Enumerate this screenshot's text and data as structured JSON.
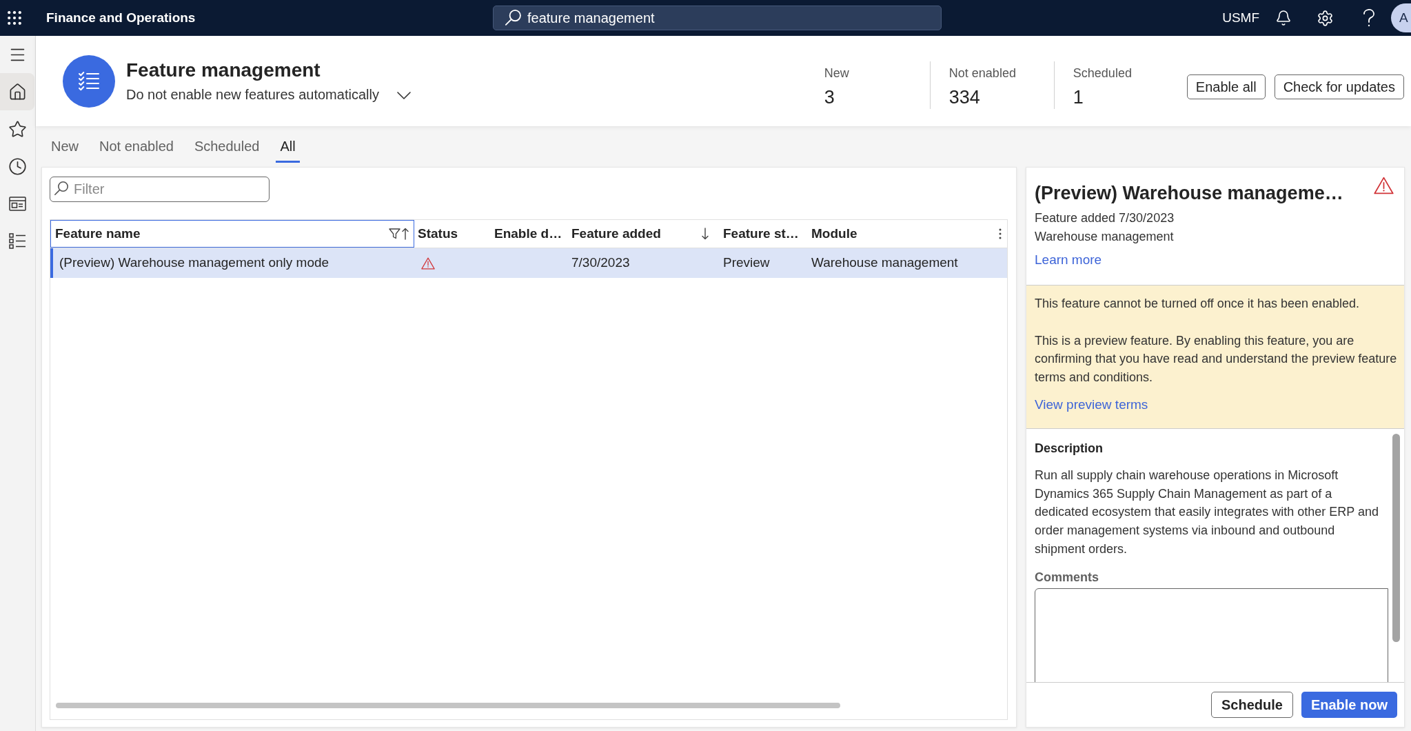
{
  "top_bar": {
    "app_title": "Finance and Operations",
    "search": {
      "value": "feature management"
    },
    "company": "USMF",
    "avatar": {
      "initial": "A"
    }
  },
  "nav_items": [
    {
      "kind": "home",
      "selected": true
    },
    {
      "kind": "favorites",
      "selected": false
    },
    {
      "kind": "recent",
      "selected": false
    },
    {
      "kind": "workspaces",
      "selected": false
    },
    {
      "kind": "modules",
      "selected": false
    }
  ],
  "header": {
    "title": "Feature management",
    "mode_dropdown": {
      "value": "Do not enable new features automatically"
    },
    "stats": [
      {
        "label": "New",
        "value": "3"
      },
      {
        "label": "Not enabled",
        "value": "334"
      },
      {
        "label": "Scheduled",
        "value": "1"
      }
    ],
    "buttons": [
      {
        "label": "Enable all"
      },
      {
        "label": "Check for updates"
      }
    ]
  },
  "tabs": [
    {
      "label": "New",
      "selected": false
    },
    {
      "label": "Not enabled",
      "selected": false
    },
    {
      "label": "Scheduled",
      "selected": false
    },
    {
      "label": "All",
      "selected": true
    }
  ],
  "filter": {
    "placeholder": "Filter"
  },
  "table": {
    "columns": [
      {
        "label": "Feature name",
        "focused": true,
        "filtered": true,
        "sorted_ascending": true,
        "sorted_descending": false
      },
      {
        "label": "Status",
        "focused": false,
        "filtered": false,
        "sorted_ascending": false,
        "sorted_descending": false
      },
      {
        "label": "Enable d…",
        "focused": false,
        "filtered": false,
        "sorted_ascending": false,
        "sorted_descending": false
      },
      {
        "label": "Feature added",
        "focused": false,
        "filtered": false,
        "sorted_ascending": false,
        "sorted_descending": true
      },
      {
        "label": "Feature st…",
        "focused": false,
        "filtered": false,
        "sorted_ascending": false,
        "sorted_descending": false
      },
      {
        "label": "Module",
        "focused": false,
        "filtered": false,
        "sorted_ascending": false,
        "sorted_descending": false
      }
    ],
    "rows": [
      {
        "selected": true,
        "feature_name": "(Preview) Warehouse management only mode",
        "warning": true,
        "feature_added": "7/30/2023",
        "feature_state": "Preview",
        "module": "Warehouse management"
      }
    ]
  },
  "details": {
    "title": "(Preview) Warehouse manageme…",
    "warning": true,
    "added": "Feature added 7/30/2023",
    "module": "Warehouse management",
    "link": "Learn more",
    "notice": {
      "paragraphs": [
        "This feature cannot be turned off once it has been enabled.",
        "This is a preview feature. By enabling this feature, you are confirming that you have read and understand the preview feature terms and conditions."
      ],
      "link": "View preview terms"
    },
    "description": {
      "heading": "Description",
      "text": "Run all supply chain warehouse operations in Microsoft Dynamics 365 Supply Chain Management as part of a dedicated ecosystem that easily integrates with other ERP and order management systems via inbound and outbound shipment orders."
    },
    "comments": {
      "label": "Comments"
    },
    "buttons": [
      {
        "label": "Schedule",
        "kind": "secondary"
      },
      {
        "label": "Enable now",
        "kind": "primary"
      }
    ]
  }
}
